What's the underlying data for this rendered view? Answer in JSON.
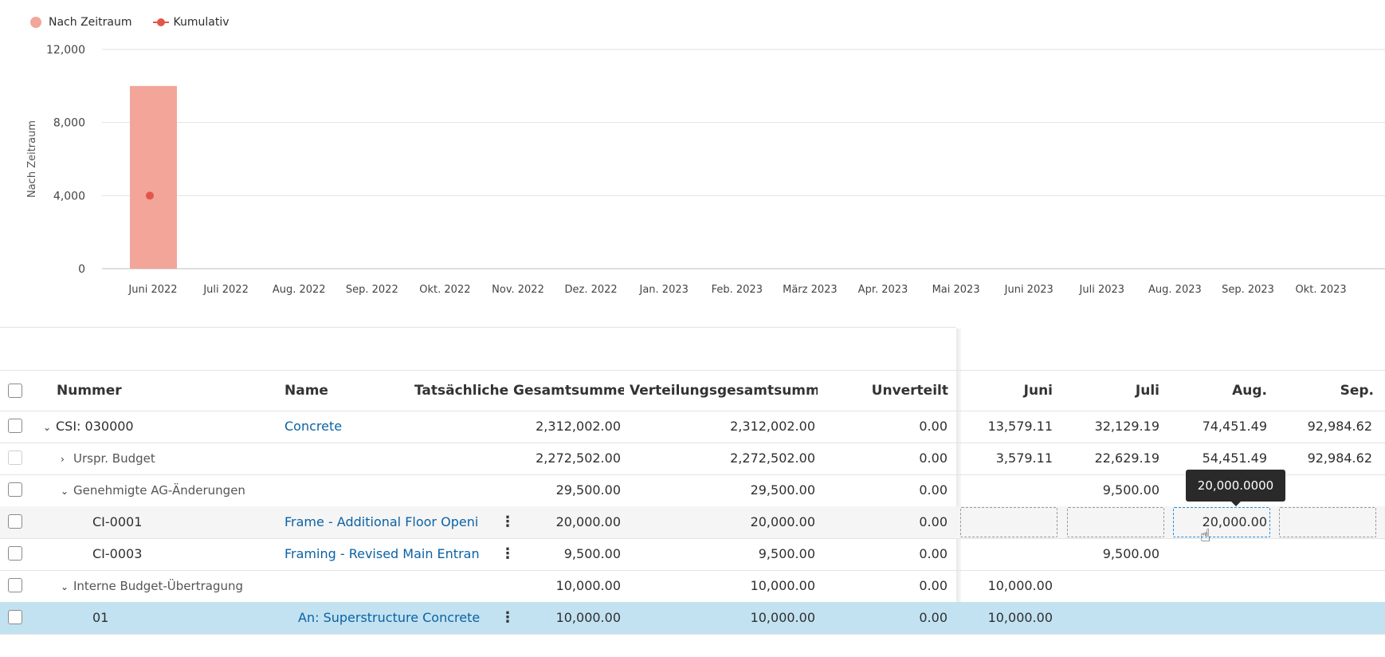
{
  "chart_data": {
    "type": "bar",
    "categories": [
      "Juni 2022",
      "Juli 2022",
      "Aug. 2022",
      "Sep. 2022",
      "Okt. 2022",
      "Nov. 2022",
      "Dez. 2022",
      "Jan. 2023",
      "Feb. 2023",
      "März 2023",
      "Apr. 2023",
      "Mai 2023",
      "Juni 2023",
      "Juli 2023",
      "Aug. 2023",
      "Sep. 2023",
      "Okt. 2023"
    ],
    "series": [
      {
        "name": "Nach Zeitraum",
        "type": "bar",
        "color": "#f3a59a",
        "values": [
          10000,
          0,
          0,
          0,
          0,
          0,
          0,
          0,
          0,
          0,
          0,
          0,
          0,
          0,
          0,
          0,
          0
        ]
      },
      {
        "name": "Kumulativ",
        "type": "line",
        "color": "#e2564a",
        "values": [
          4000,
          null,
          null,
          null,
          null,
          null,
          null,
          null,
          null,
          null,
          null,
          null,
          null,
          null,
          null,
          null,
          null
        ]
      }
    ],
    "ylabel": "Nach Zeitraum",
    "ylim": [
      0,
      12000
    ],
    "yticks": [
      0,
      4000,
      8000,
      12000
    ],
    "ytick_labels": [
      "0",
      "4,000",
      "8,000",
      "12,000"
    ],
    "legend_position": "top-left",
    "grid": true
  },
  "legend": {
    "bar_label": "Nach Zeitraum",
    "line_label": "Kumulativ"
  },
  "table": {
    "headers": {
      "number": "Nummer",
      "name": "Name",
      "actual_total": "Tatsächliche Gesamtsumme",
      "distribution_total": "Verteilungsgesamtsumme",
      "unallocated": "Unverteilt",
      "m1": "Juni",
      "m2": "Juli",
      "m3": "Aug.",
      "m4": "Sep."
    },
    "rows": [
      {
        "number": "CSI: 030000",
        "name": "Concrete",
        "actual": "2,312,002.00",
        "dist": "2,312,002.00",
        "unalloc": "0.00",
        "m1": "13,579.11",
        "m2": "32,129.19",
        "m3": "74,451.49",
        "m4": "92,984.62"
      },
      {
        "number": "Urspr. Budget",
        "name": "",
        "actual": "2,272,502.00",
        "dist": "2,272,502.00",
        "unalloc": "0.00",
        "m1": "3,579.11",
        "m2": "22,629.19",
        "m3": "54,451.49",
        "m4": "92,984.62"
      },
      {
        "number": "Genehmigte AG-Änderungen",
        "name": "",
        "actual": "29,500.00",
        "dist": "29,500.00",
        "unalloc": "0.00",
        "m1": "",
        "m2": "9,500.00",
        "m3": "",
        "m4": ""
      },
      {
        "number": "CI-0001",
        "name": "Frame - Additional Floor Openi…",
        "actual": "20,000.00",
        "dist": "20,000.00",
        "unalloc": "0.00",
        "m1": "",
        "m2": "",
        "m3": "20,000.00",
        "m4": ""
      },
      {
        "number": "CI-0003",
        "name": "Framing - Revised Main Entran…",
        "actual": "9,500.00",
        "dist": "9,500.00",
        "unalloc": "0.00",
        "m1": "",
        "m2": "9,500.00",
        "m3": "",
        "m4": ""
      },
      {
        "number": "Interne Budget-Übertragung",
        "name": "",
        "actual": "10,000.00",
        "dist": "10,000.00",
        "unalloc": "0.00",
        "m1": "10,000.00",
        "m2": "",
        "m3": "",
        "m4": ""
      },
      {
        "number": "01",
        "name": "An: Superstructure Concrete",
        "actual": "10,000.00",
        "dist": "10,000.00",
        "unalloc": "0.00",
        "m1": "10,000.00",
        "m2": "",
        "m3": "",
        "m4": ""
      }
    ]
  },
  "tooltip": {
    "text": "20,000.0000"
  },
  "colors": {
    "link": "#0b62a4",
    "selected_row": "#c2e2f1",
    "bar": "#f3a59a",
    "line": "#e2564a"
  }
}
